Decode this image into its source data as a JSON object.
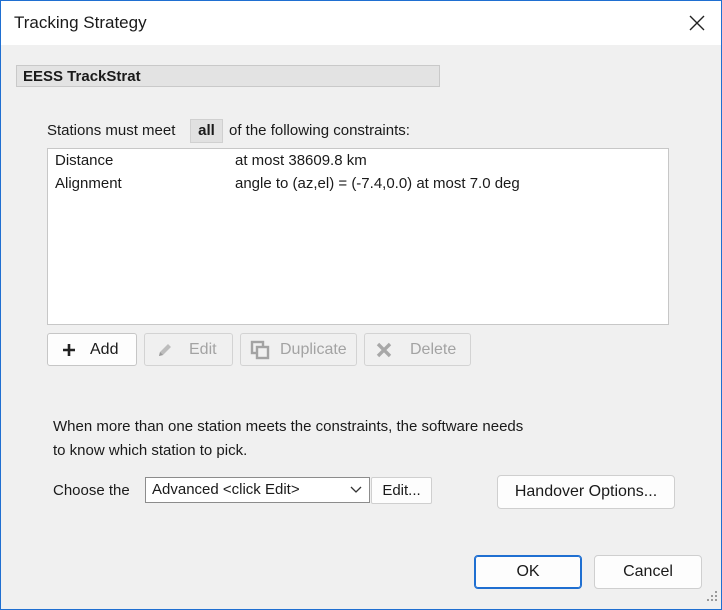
{
  "window": {
    "title": "Tracking Strategy"
  },
  "strategy_name": "EESS TrackStrat",
  "constraints": {
    "prefix": "Stations must meet",
    "mode": "all",
    "suffix": "of the following constraints:",
    "rows": [
      {
        "name": "Distance",
        "value": "at most 38609.8 km"
      },
      {
        "name": "Alignment",
        "value": "angle to (az,el) = (-7.4,0.0) at most 7.0 deg"
      }
    ]
  },
  "buttons": {
    "add": "Add",
    "edit": "Edit",
    "duplicate": "Duplicate",
    "delete": "Delete"
  },
  "explanation": {
    "line1": "When more than one station meets the constraints, the software needs",
    "line2": "to know which station to pick."
  },
  "choose": {
    "label": "Choose the",
    "selected": "Advanced <click Edit>",
    "edit_button": "Edit...",
    "handover_button": "Handover Options..."
  },
  "dialog": {
    "ok": "OK",
    "cancel": "Cancel"
  },
  "colors": {
    "accent": "#1f6fd1"
  }
}
